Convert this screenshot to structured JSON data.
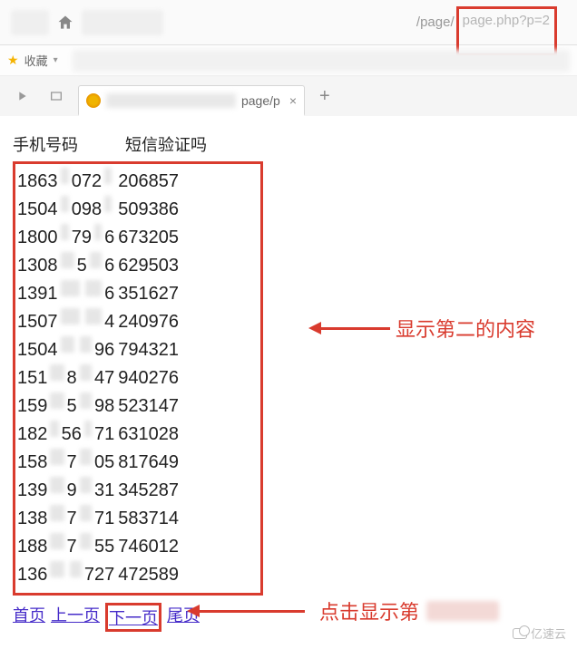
{
  "browser": {
    "url_suffix_plain": "/page/",
    "url_suffix_highlighted": "page.php?p=2",
    "bookmark_label": "收藏",
    "tab": {
      "title_suffix": "page/p",
      "close": "×",
      "new": "+"
    }
  },
  "table": {
    "header_phone": "手机号码",
    "header_code": "短信验证吗",
    "rows": [
      {
        "p1": "1863",
        "p2": "072",
        "p3": "",
        "code": "206857"
      },
      {
        "p1": "1504",
        "p2": "098",
        "p3": "",
        "code": "509386"
      },
      {
        "p1": "1800",
        "p2": "79",
        "p3": "6",
        "code": "673205"
      },
      {
        "p1": "1308",
        "p2": "5",
        "p3": "6",
        "code": "629503"
      },
      {
        "p1": "1391",
        "p2": "",
        "p3": "6",
        "code": "351627"
      },
      {
        "p1": "1507",
        "p2": "",
        "p3": "4",
        "code": "240976"
      },
      {
        "p1": "1504",
        "p2": "",
        "p3": "96",
        "code": "794321"
      },
      {
        "p1": "151",
        "p2": "8",
        "p3": "47",
        "code": "940276"
      },
      {
        "p1": "159",
        "p2": "5",
        "p3": "98",
        "code": "523147"
      },
      {
        "p1": "182",
        "p2": "56",
        "p3": "71",
        "code": "631028"
      },
      {
        "p1": "158",
        "p2": "7",
        "p3": "05",
        "code": "817649"
      },
      {
        "p1": "139",
        "p2": "9",
        "p3": "31",
        "code": "345287"
      },
      {
        "p1": "138",
        "p2": "7",
        "p3": "71",
        "code": "583714"
      },
      {
        "p1": "188",
        "p2": "7",
        "p3": "55",
        "code": "746012"
      },
      {
        "p1": "136",
        "p2": "",
        "p3": "727",
        "code": "472589"
      }
    ]
  },
  "pagination": {
    "first": "首页",
    "prev": "上一页",
    "next": "下一页",
    "last": "尾页"
  },
  "annotations": {
    "line1": "显示第二的内容",
    "line2_prefix": "点击显示第"
  },
  "watermark": "亿速云"
}
